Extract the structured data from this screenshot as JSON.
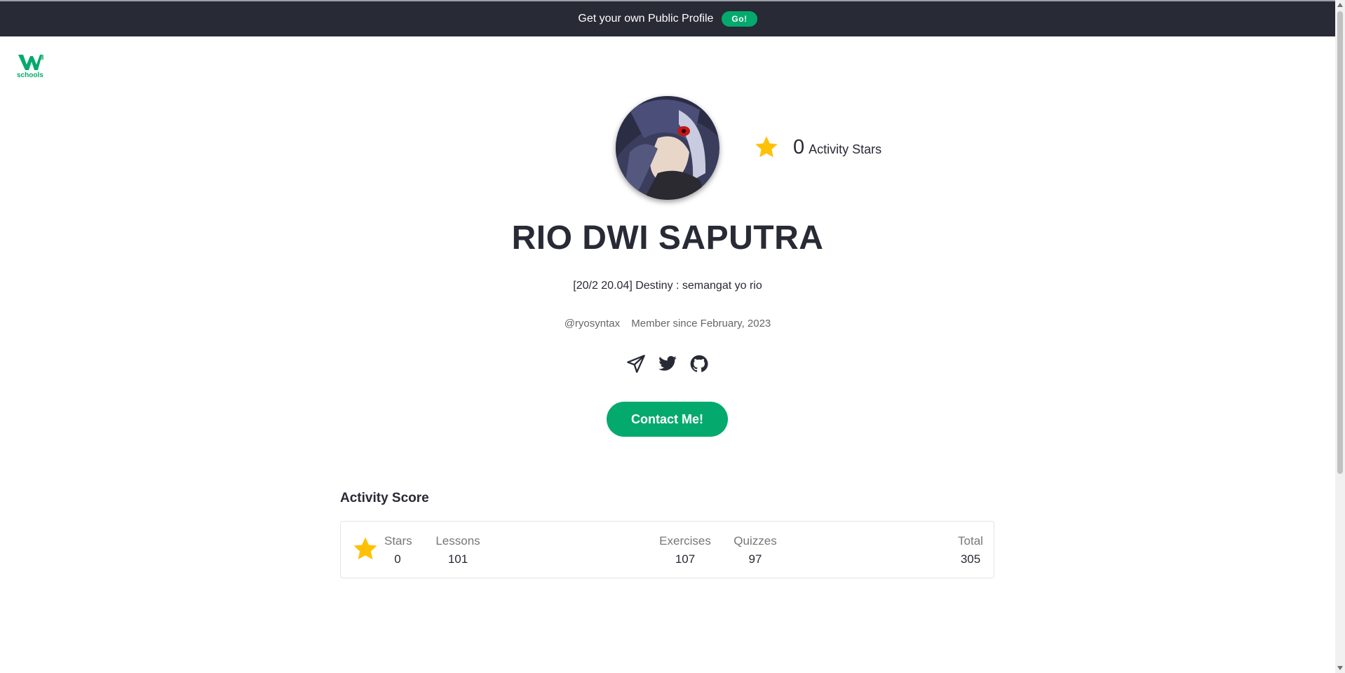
{
  "banner": {
    "text": "Get your own Public Profile",
    "go_label": "Go!"
  },
  "logo": {
    "sup": "3",
    "text": "schools"
  },
  "profile": {
    "activity_stars_count": "0",
    "activity_stars_label": "Activity Stars",
    "name": "RIO DWI SAPUTRA",
    "bio": "[20/2 20.04] Destiny : semangat yo rio",
    "username": "@ryosyntax",
    "member_since": "Member since February, 2023",
    "contact_label": "Contact Me!"
  },
  "social_icons": [
    "paper-plane-icon",
    "twitter-icon",
    "github-icon"
  ],
  "activity_score": {
    "title": "Activity Score",
    "columns": [
      {
        "label": "Stars",
        "value": "0"
      },
      {
        "label": "Lessons",
        "value": "101"
      },
      {
        "label": "Exercises",
        "value": "107"
      },
      {
        "label": "Quizzes",
        "value": "97"
      },
      {
        "label": "Total",
        "value": "305"
      }
    ]
  },
  "colors": {
    "brand": "#04aa6d",
    "dark": "#282a35",
    "star": "#ffc107"
  }
}
